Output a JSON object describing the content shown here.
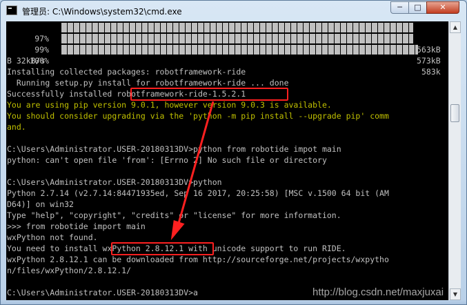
{
  "window": {
    "title": "管理员: C:\\Windows\\system32\\cmd.exe",
    "controls": {
      "minimize": "─",
      "maximize": "□",
      "close": "✕"
    }
  },
  "console": {
    "progress_rows": [
      {
        "percent": "97%",
        "bar_fill": 0.97,
        "size": "563kB"
      },
      {
        "percent": "99%",
        "bar_fill": 0.99,
        "size": "573kB"
      },
      {
        "percent": "100%",
        "bar_fill": 1.0,
        "size": "583k"
      }
    ],
    "lines": [
      {
        "text": "B 32kB/s",
        "color": "gray"
      },
      {
        "text": "Installing collected packages: robotframework-ride",
        "color": "gray"
      },
      {
        "text": "  Running setup.py install for robotframework-ride ... done",
        "color": "gray"
      },
      {
        "text": "Successfully installed robotframework-ride-1.5.2.1",
        "color": "gray"
      },
      {
        "text": "You are using pip version 9.0.1, however version 9.0.3 is available.",
        "color": "yellow"
      },
      {
        "text": "You should consider upgrading via the 'python -m pip install --upgrade pip' comm",
        "color": "yellow"
      },
      {
        "text": "and.",
        "color": "yellow"
      },
      {
        "text": "",
        "color": "gray"
      },
      {
        "text": "C:\\Users\\Administrator.USER-20180313DV>python from robotide impot main",
        "color": "gray"
      },
      {
        "text": "python: can't open file 'from': [Errno 2] No such file or directory",
        "color": "gray"
      },
      {
        "text": "",
        "color": "gray"
      },
      {
        "text": "C:\\Users\\Administrator.USER-20180313DV>python",
        "color": "gray"
      },
      {
        "text": "Python 2.7.14 (v2.7.14:84471935ed, Sep 16 2017, 20:25:58) [MSC v.1500 64 bit (AM",
        "color": "gray"
      },
      {
        "text": "D64)] on win32",
        "color": "gray"
      },
      {
        "text": "Type \"help\", \"copyright\", \"credits\" or \"license\" for more information.",
        "color": "gray"
      },
      {
        "text": ">>> from robotide import main",
        "color": "gray"
      },
      {
        "text": "wxPython not found.",
        "color": "gray"
      },
      {
        "text": "You need to install wxPython 2.8.12.1 with unicode support to run RIDE.",
        "color": "gray"
      },
      {
        "text": "wxPython 2.8.12.1 can be downloaded from http://sourceforge.net/projects/wxpytho",
        "color": "gray"
      },
      {
        "text": "n/files/wxPython/2.8.12.1/",
        "color": "gray"
      },
      {
        "text": "",
        "color": "gray"
      },
      {
        "text": "C:\\Users\\Administrator.USER-20180313DV>a",
        "color": "gray"
      }
    ],
    "highlights": [
      "robotframework-ride-1.5.2.1",
      "wxPython 2.8.12.1"
    ]
  },
  "watermark": "http://blog.csdn.net/maxjuxai",
  "colors": {
    "console_bg": "#000000",
    "console_text": "#c0c0c0",
    "warning_text": "#c0c000",
    "highlight": "#ff2020"
  }
}
